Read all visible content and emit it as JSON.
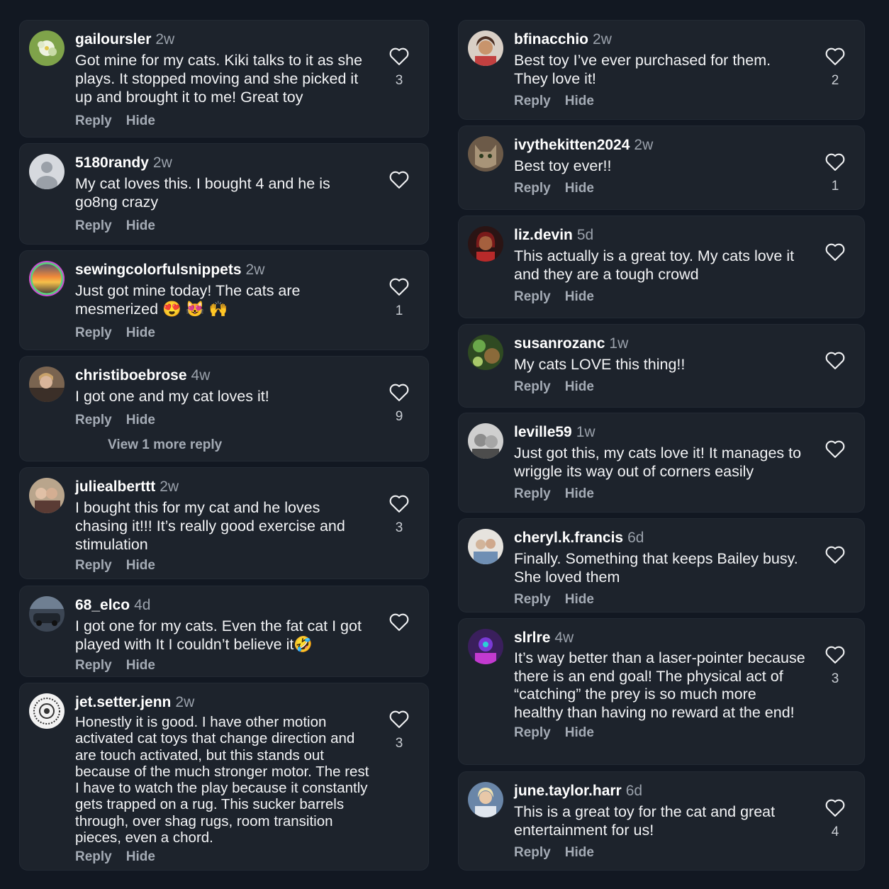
{
  "actions": {
    "reply": "Reply",
    "hide": "Hide"
  },
  "left": [
    {
      "user": "gailoursler",
      "age": "2w",
      "text": "Got mine for my cats. Kiki talks to it as she plays. It stopped moving and she picked it up and brought it to me! Great toy",
      "likes": "3"
    },
    {
      "user": "5180randy",
      "age": "2w",
      "text": "My cat loves this. I bought 4 and he is go8ng crazy",
      "likes": ""
    },
    {
      "user": "sewingcolorfulsnippets",
      "age": "2w",
      "text": "Just got mine today! The cats are mesmerized 😍 😻 🙌",
      "likes": "1"
    },
    {
      "user": "christiboebrose",
      "age": "4w",
      "text": "I got one and my cat loves it!",
      "likes": "9",
      "more": "View 1 more reply"
    },
    {
      "user": "juliealberttt",
      "age": "2w",
      "text": "I bought this for my cat and he loves chasing it!!! It’s really good exercise and stimulation",
      "likes": "3"
    },
    {
      "user": "68_elco",
      "age": "4d",
      "text": "I got one for my cats. Even the fat cat I got played with It I couldn’t believe it🤣",
      "likes": ""
    },
    {
      "user": "jet.setter.jenn",
      "age": "2w",
      "text": "Honestly it is  good. I have other motion activated cat toys that change direction and are touch activated, but this stands out because of the much stronger motor. The rest I have to watch the play because it constantly gets trapped on a rug. This sucker barrels through, over shag rugs, room transition pieces, even a chord.",
      "likes": "3"
    }
  ],
  "right": [
    {
      "user": "bfinacchio",
      "age": "2w",
      "text": "Best toy I’ve ever purchased for them. They love it!",
      "likes": "2"
    },
    {
      "user": "ivythekitten2024",
      "age": "2w",
      "text": "Best toy ever!!",
      "likes": "1"
    },
    {
      "user": "liz.devin",
      "age": "5d",
      "text": "This actually is a great toy. My cats love it and they are a tough crowd",
      "likes": ""
    },
    {
      "user": "susanrozanc",
      "age": "1w",
      "text": "My cats LOVE this thing!!",
      "likes": ""
    },
    {
      "user": "leville59",
      "age": "1w",
      "text": "Just got this, my cats love it! It manages to wriggle its way out of corners easily",
      "likes": ""
    },
    {
      "user": "cheryl.k.francis",
      "age": "6d",
      "text": "Finally. Something that keeps Bailey busy. She loved them",
      "likes": ""
    },
    {
      "user": "slrlre",
      "age": "4w",
      "text": "It’s way better than a laser-pointer because there is an end goal! The physical act of “catching” the prey is so much more healthy than having no reward at the end!",
      "likes": "3"
    },
    {
      "user": "june.taylor.harr",
      "age": "6d",
      "text": "This is a great toy for the cat and great entertainment for us!",
      "likes": "4"
    }
  ]
}
